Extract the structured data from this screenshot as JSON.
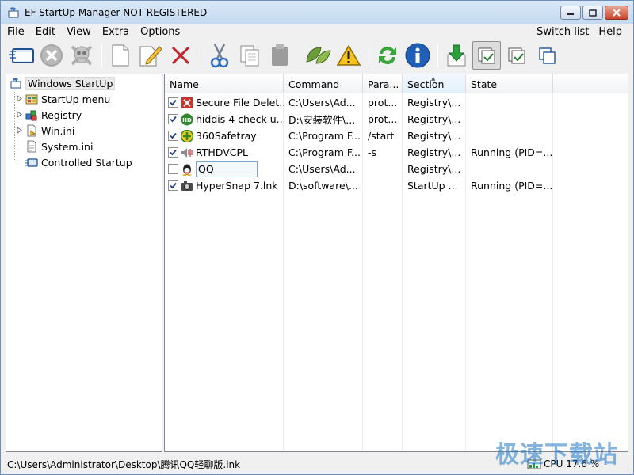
{
  "window": {
    "title": "EF StartUp Manager NOT REGISTERED"
  },
  "menu": {
    "items": [
      "File",
      "Edit",
      "View",
      "Extra",
      "Options"
    ],
    "right_items": [
      "Switch list",
      "Help"
    ]
  },
  "toolbar": {
    "buttons": [
      "edit-window-icon",
      "cancel-circle-icon",
      "skull-icon",
      "new-document-icon",
      "edit-pencil-icon",
      "delete-x-icon",
      "cut-scissors-icon",
      "copy-icon",
      "paste-icon",
      "leaf-icon",
      "warning-icon",
      "refresh-icon",
      "info-icon",
      "download-arrow-icon",
      "check-all-icon",
      "check-icon",
      "windows-icon"
    ]
  },
  "tree": {
    "root": "Windows StartUp",
    "children": [
      "StartUp menu",
      "Registry",
      "Win.ini",
      "System.ini",
      "Controlled Startup"
    ]
  },
  "list": {
    "columns": [
      "Name",
      "Command",
      "Para...",
      "Section",
      "State"
    ],
    "rows": [
      {
        "checked": true,
        "icon": "secure-delete-icon",
        "name": "Secure File Delet...",
        "command": "C:\\Users\\Ad...",
        "param": "prot...",
        "section": "Registry\\...",
        "state": ""
      },
      {
        "checked": true,
        "icon": "hd-icon",
        "name": "hiddis 4 check u...",
        "command": "D:\\安装软件\\...",
        "param": "prot...",
        "section": "Registry\\...",
        "state": ""
      },
      {
        "checked": true,
        "icon": "safetray-icon",
        "name": "360Safetray",
        "command": "C:\\Program F...",
        "param": "/start",
        "section": "Registry\\...",
        "state": ""
      },
      {
        "checked": true,
        "icon": "audio-icon",
        "name": "RTHDVCPL",
        "command": "C:\\Program F...",
        "param": "-s",
        "section": "Registry\\...",
        "state": "Running (PID=..."
      },
      {
        "checked": false,
        "icon": "qq-penguin-icon",
        "name": "QQ",
        "command": "C:\\Users\\Ad...",
        "param": "",
        "section": "Registry\\...",
        "state": ""
      },
      {
        "checked": true,
        "icon": "camera-icon",
        "name": "HyperSnap 7.lnk",
        "command": "D:\\software\\...",
        "param": "",
        "section": "StartUp ...",
        "state": "Running (PID=..."
      }
    ]
  },
  "status": {
    "path": "C:\\Users\\Administrator\\Desktop\\腾讯QQ轻聊版.lnk",
    "cpu": "CPU 17.6 %"
  },
  "watermark": "极速下载站",
  "colors": {
    "selection_border": "#7da2ce",
    "title_gradient_top": "#dbe9f8",
    "close_button": "#c8462c"
  }
}
